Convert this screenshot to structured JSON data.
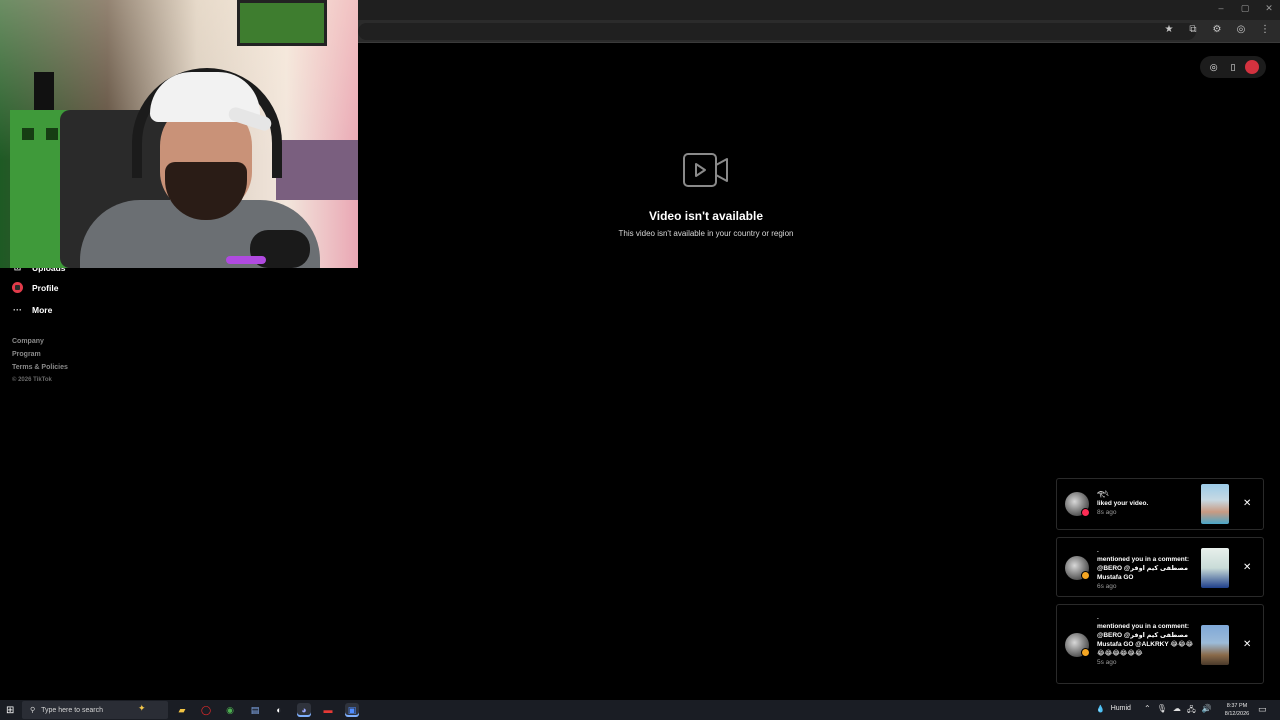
{
  "browser": {
    "window_controls": [
      "–",
      "▢",
      "✕"
    ],
    "toolbar_icons": [
      "★",
      "⧉",
      "⚙",
      "◎",
      "⋮"
    ]
  },
  "sidebar": {
    "items": [
      {
        "label": "Uploads",
        "icon": "upload-icon"
      },
      {
        "label": "Profile",
        "icon": "profile-icon"
      },
      {
        "label": "More",
        "icon": "more-icon"
      }
    ],
    "footer": [
      "Company",
      "Program",
      "Terms & Policies"
    ],
    "copyright": "© 2026 TikTok"
  },
  "top_actions": {
    "icons": [
      "compass-icon",
      "phone-icon",
      "avatar"
    ],
    "glyphs": [
      "◎",
      "▯"
    ]
  },
  "video": {
    "title": "Video isn't available",
    "subtitle": "This video isn't available in your country or region"
  },
  "notifications": [
    {
      "user": "𓂀𓆩",
      "text": "liked your video.",
      "time": "8s ago",
      "badge_color": "#fe2c55"
    },
    {
      "user": ".",
      "text": "mentioned you in a comment: @BERO @مصطفى كيم اوفر Mustafa GO",
      "time": "6s ago",
      "badge_color": "#f5a623"
    },
    {
      "user": ".",
      "text": "mentioned you in a comment: @BERO @مصطفى كيم اوفر Mustafa GO @ALKRKY 😂😂😂😂😂😂😂😂😂",
      "time": "5s ago",
      "badge_color": "#f5a623"
    }
  ],
  "close_glyph": "✕",
  "taskbar": {
    "search_placeholder": "Type here to search",
    "weather": "Humid",
    "time": "8:37 PM",
    "date": "8/12/2026"
  }
}
